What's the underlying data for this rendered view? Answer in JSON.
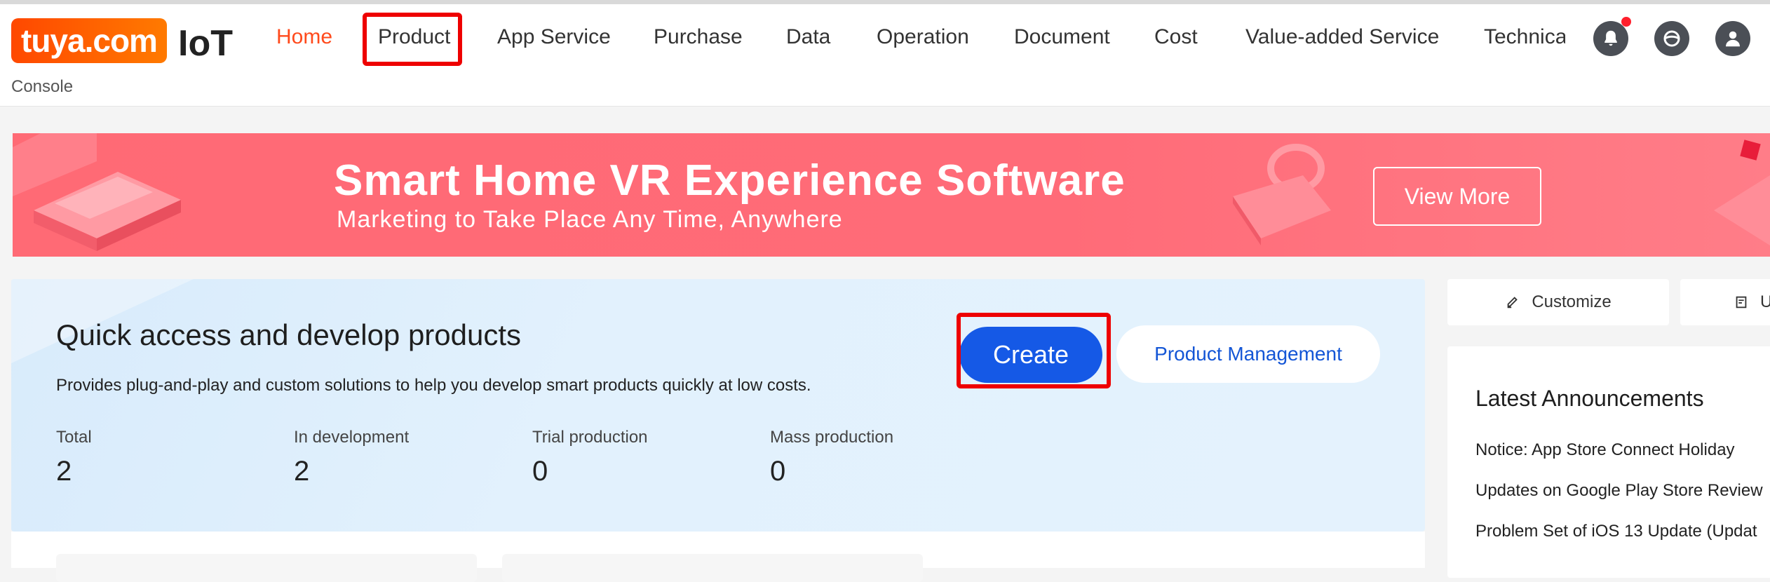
{
  "header": {
    "logo_text": "tuya.com",
    "brand": "IoT",
    "console": "Console",
    "nav": [
      "Home",
      "Product",
      "App Service",
      "Purchase",
      "Data",
      "Operation",
      "Document",
      "Cost",
      "Value-added Service"
    ],
    "nav_truncated": "Technica",
    "active_index": 0,
    "icons": [
      "bell-icon",
      "globe-icon",
      "user-icon"
    ],
    "accent_color": "#ff4a1c"
  },
  "banner": {
    "title": "Smart Home VR Experience Software",
    "subtitle": "Marketing to Take Place Any Time, Anywhere",
    "button": "View More"
  },
  "panel": {
    "title": "Quick access and develop products",
    "description": "Provides plug-and-play and custom solutions to help you develop smart products quickly at low costs.",
    "create_button": "Create",
    "management_button": "Product Management",
    "stats": [
      {
        "label": "Total",
        "value": "2"
      },
      {
        "label": "In development",
        "value": "2"
      },
      {
        "label": "Trial production",
        "value": "0"
      },
      {
        "label": "Mass production",
        "value": "0"
      }
    ]
  },
  "side": {
    "customize": "Customize",
    "second_button_partial": "U",
    "announcements_title": "Latest Announcements",
    "announcements": [
      "Notice: App Store Connect Holiday",
      "Updates on Google Play Store Review",
      "Problem Set of iOS 13 Update (Updat"
    ]
  }
}
